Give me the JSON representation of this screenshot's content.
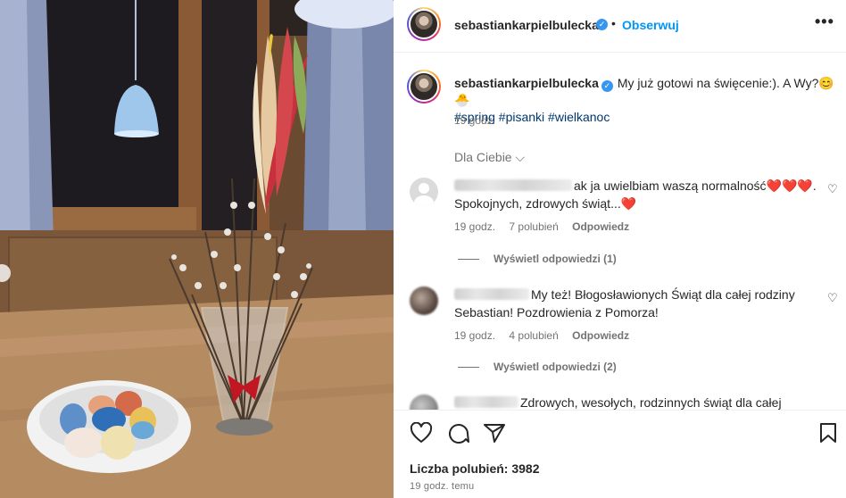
{
  "post": {
    "username": "sebastiankarpielbulecka",
    "follow_label": "Obserwuj",
    "more_label": "•••",
    "dot": "•",
    "verified_mark": "✓"
  },
  "caption": {
    "username": "sebastiankarpielbulecka",
    "text": "My już gotowi na święcenie:). A Wy?😊🐣",
    "hashtags": "#spring #pisanki #wielkanoc",
    "time": "19 godz."
  },
  "filter_label": "Dla Ciebie ⌵",
  "comments": [
    {
      "text": "ak ja uwielbiam waszą normalność❤️❤️❤️. Spokojnych, zdrowych świąt...❤️",
      "time": "19 godz.",
      "likes": "7 polubień",
      "reply": "Odpowiedz",
      "view_replies": "Wyświetl odpowiedzi (1)"
    },
    {
      "text": "My też! Błogosławionych Świąt dla całej rodziny Sebastian! Pozdrowienia z Pomorza!",
      "time": "19 godz.",
      "likes": "4 polubień",
      "reply": "Odpowiedz",
      "view_replies": "Wyświetl odpowiedzi (2)"
    },
    {
      "text": "Zdrowych, wesołych, rodzinnych świąt dla całej"
    }
  ],
  "likes_count": "Liczba polubień: 3982",
  "post_time": "19 godz. temu",
  "icons": [
    "heart-icon",
    "comment-icon",
    "share-icon",
    "save-icon",
    "verified-icon"
  ],
  "colors": {
    "link_blue": "#0095f6",
    "hashtag": "#00376b",
    "heart_red": "#e0245e",
    "muted": "#737373"
  }
}
